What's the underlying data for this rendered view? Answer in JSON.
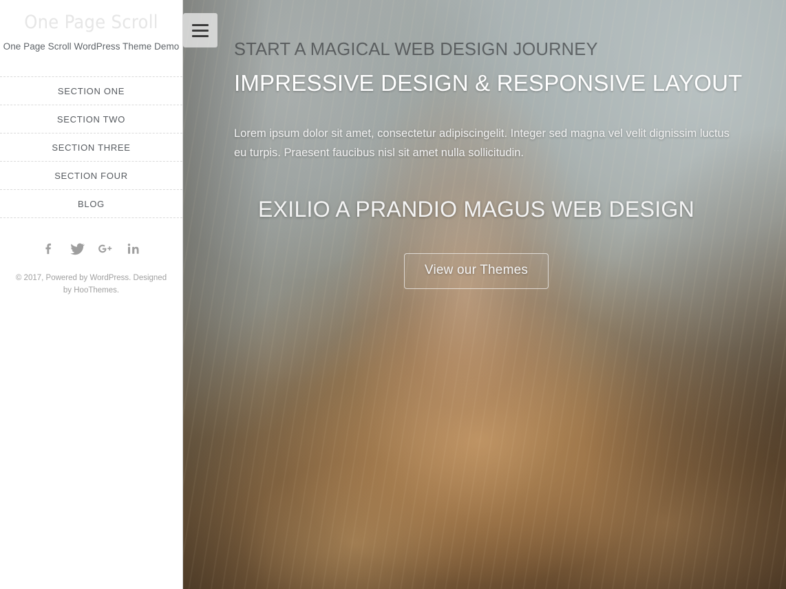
{
  "sidebar": {
    "site_title": "One Page Scroll",
    "tagline": "One Page Scroll WordPress Theme Demo",
    "nav_items": [
      {
        "label": "SECTION ONE",
        "name": "sidebar-nav-section-one"
      },
      {
        "label": "SECTION TWO",
        "name": "sidebar-nav-section-two"
      },
      {
        "label": "SECTION THREE",
        "name": "sidebar-nav-section-three"
      },
      {
        "label": "SECTION FOUR",
        "name": "sidebar-nav-section-four"
      },
      {
        "label": "BLOG",
        "name": "sidebar-nav-blog"
      }
    ],
    "social": [
      {
        "icon": "facebook-icon",
        "label": "Facebook"
      },
      {
        "icon": "twitter-icon",
        "label": "Twitter"
      },
      {
        "icon": "googleplus-icon",
        "label": "Google Plus"
      },
      {
        "icon": "linkedin-icon",
        "label": "LinkedIn"
      }
    ],
    "credit": "© 2017, Powered by WordPress. Designed by HooThemes."
  },
  "hero": {
    "menu_toggle_icon": "hamburger-icon",
    "eyebrow": "START A MAGICAL WEB DESIGN JOURNEY",
    "heading": "IMPRESSIVE DESIGN & RESPONSIVE LAYOUT",
    "paragraph": "Lorem ipsum dolor sit amet, consectetur adipiscingelit. Integer sed magna vel velit dignissim luctus eu turpis. Praesent faucibus nisl sit amet nulla sollicitudin.",
    "subheading": "EXILIO A PRANDIO MAGUS WEB DESIGN",
    "cta_label": "View our Themes",
    "scroll_indicator": "···"
  },
  "colors": {
    "sidebar_bg": "#ffffff",
    "sidebar_border": "#d8d8d8",
    "nav_text": "#55595e",
    "site_title": "#e6e6e6",
    "tagline": "#5e6368",
    "credit": "#a0a0a0",
    "social_icon": "#9e9e9e",
    "separator": "#dadada",
    "hero_heading": "#ffffff",
    "hero_eyebrow": "#2a2c2e",
    "toggle_bg": "#e9e9e9",
    "toggle_bar": "#3a3a3a"
  }
}
